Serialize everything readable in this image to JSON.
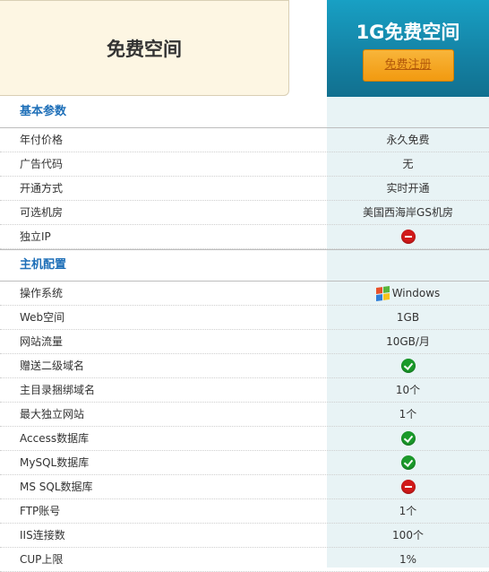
{
  "header": {
    "left_title": "免费空间",
    "plan_title": "1G免费空间",
    "register_label": "免费注册"
  },
  "sections": [
    {
      "title": "基本参数",
      "rows": [
        {
          "label": "年付价格",
          "value": "永久免费",
          "icon": null
        },
        {
          "label": "广告代码",
          "value": "无",
          "icon": null
        },
        {
          "label": "开通方式",
          "value": "实时开通",
          "icon": null
        },
        {
          "label": "可选机房",
          "value": "美国西海岸GS机房",
          "icon": null
        },
        {
          "label": "独立IP",
          "value": "",
          "icon": "no-icon"
        }
      ]
    },
    {
      "title": "主机配置",
      "rows": [
        {
          "label": "操作系统",
          "value": "Windows",
          "icon": "windows-icon"
        },
        {
          "label": "Web空间",
          "value": "1GB",
          "icon": null
        },
        {
          "label": "网站流量",
          "value": "10GB/月",
          "icon": null
        },
        {
          "label": "赠送二级域名",
          "value": "",
          "icon": "yes-icon"
        },
        {
          "label": "主目录捆绑域名",
          "value": "10个",
          "icon": null
        },
        {
          "label": "最大独立网站",
          "value": "1个",
          "icon": null
        },
        {
          "label": "Access数据库",
          "value": "",
          "icon": "yes-icon"
        },
        {
          "label": "MySQL数据库",
          "value": "",
          "icon": "yes-icon"
        },
        {
          "label": "MS SQL数据库",
          "value": "",
          "icon": "no-icon"
        },
        {
          "label": "FTP账号",
          "value": "1个",
          "icon": null
        },
        {
          "label": "IIS连接数",
          "value": "100个",
          "icon": null
        },
        {
          "label": "CUP上限",
          "value": "1%",
          "icon": null
        }
      ]
    }
  ]
}
